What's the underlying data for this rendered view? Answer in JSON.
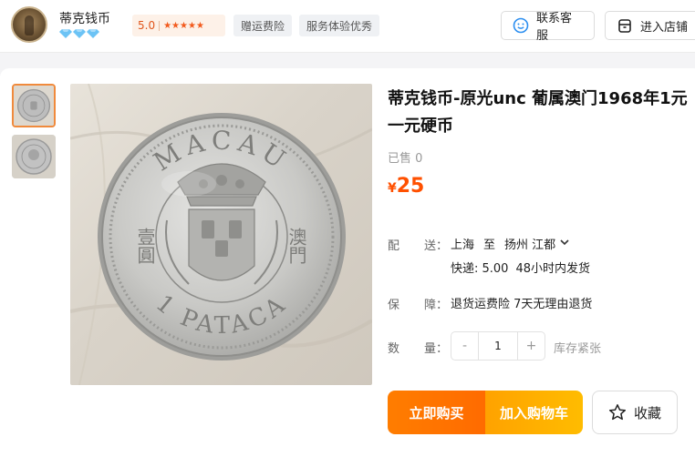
{
  "header": {
    "shop_name": "蒂克钱币",
    "rating": "5.0",
    "stars": "★★★★★",
    "tags": [
      "赠运费险",
      "服务体验优秀"
    ],
    "service_label": "联系客服",
    "store_label": "进入店铺",
    "icons": {
      "service": "chat-smile-icon",
      "store": "store-icon",
      "level": "diamond-icon"
    },
    "colors": {
      "accent": "#ff5000",
      "diamond": "#6cc3f5"
    }
  },
  "product": {
    "title": "蒂克钱币-原光unc 葡属澳门1968年1元一元硬币",
    "sold": "已售 0",
    "price_currency": "¥",
    "price": "25",
    "shipping": {
      "label_a": "配",
      "label_b": "送：",
      "from": "上海",
      "to_word": "至",
      "destination": "扬州 江都",
      "express": "快递: 5.00",
      "eta": "48小时内发货"
    },
    "guarantee": {
      "label_a": "保",
      "label_b": "障：",
      "text": "退货运费险 7天无理由退货"
    },
    "quantity": {
      "label_a": "数",
      "label_b": "量：",
      "minus": "-",
      "value": "1",
      "plus": "+",
      "stock": "库存紧张"
    },
    "buttons": {
      "buy_now": "立即购买",
      "add_cart": "加入购物车",
      "favorite": "收藏"
    }
  },
  "coin": {
    "top_text": "MACAU",
    "bottom_text": "1 PATACA",
    "left_chars": "壹圓",
    "right_chars": "澳門"
  }
}
